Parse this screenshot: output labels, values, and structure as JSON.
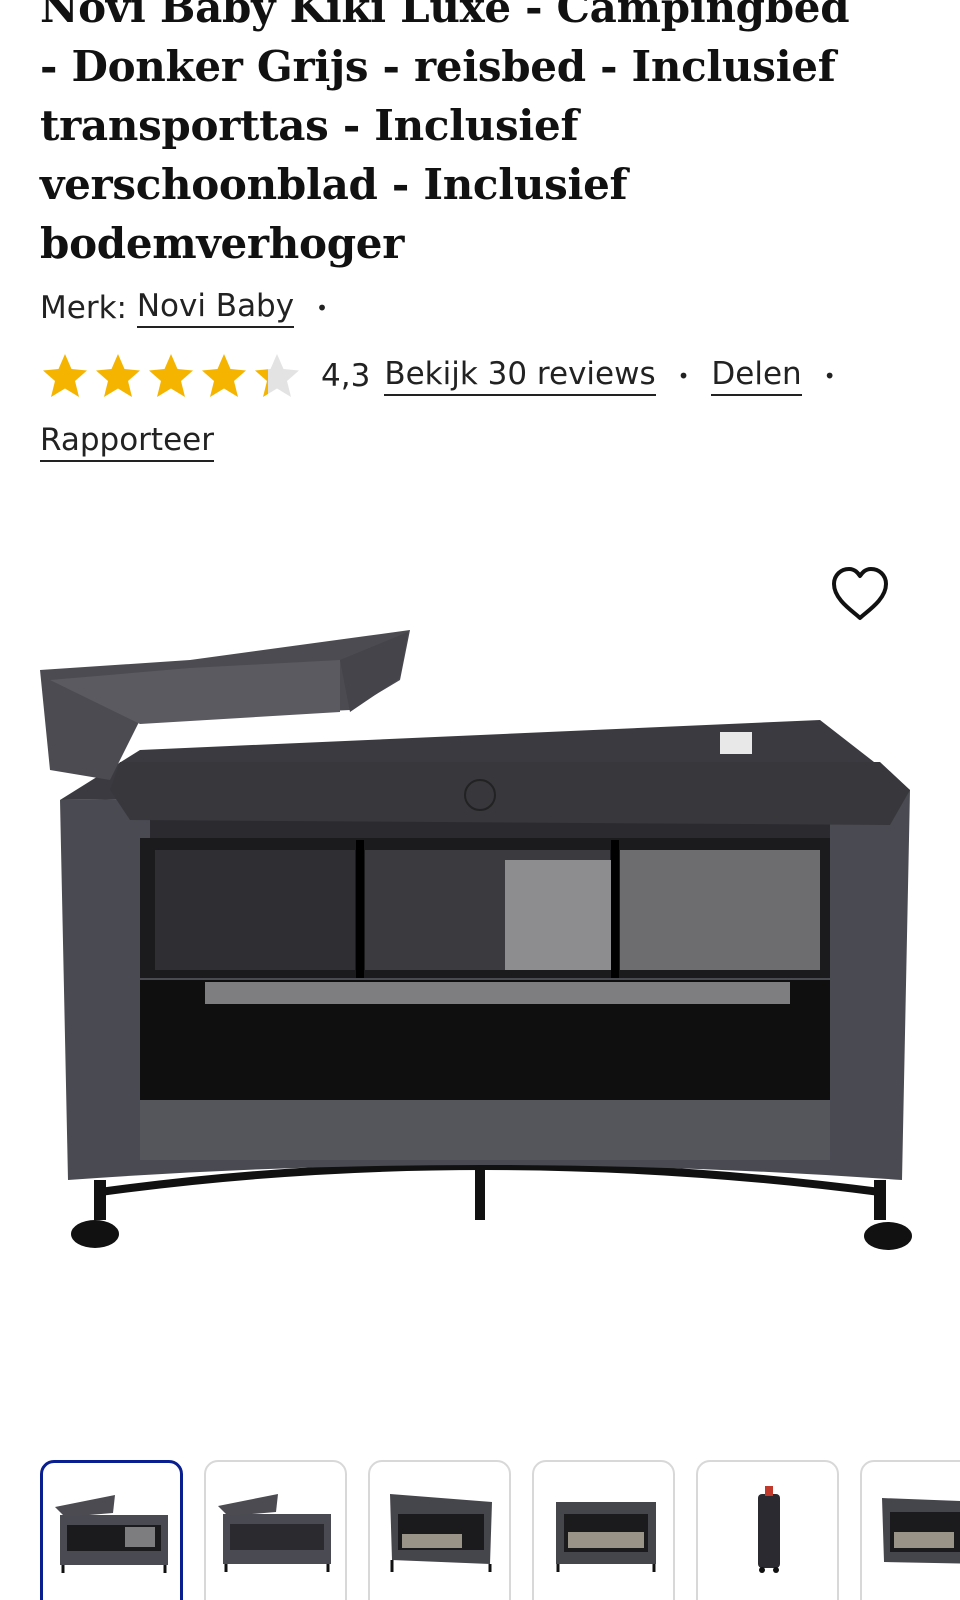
{
  "product": {
    "title_lines": [
      "Novi Baby Kiki Luxe - Campingbed",
      "- Donker Grijs - reisbed - Inclusief",
      "transporttas - Inclusief",
      "verschoonblad - Inclusief",
      "bodemverhoger"
    ],
    "brand_label": "Merk:",
    "brand_name": "Novi Baby",
    "rating_value": "4,3",
    "rating_score": 4.3,
    "rating_max": 5,
    "reviews_link": "Bekijk 30 reviews",
    "share_link": "Delen",
    "report_link": "Rapporteer",
    "separator": "•"
  },
  "colors": {
    "star_filled": "#F5B400",
    "star_empty": "#E3E3E3",
    "thumb_active_border": "#0A1F8F",
    "text": "#111111"
  },
  "icons": {
    "favorite": "heart-outline-icon",
    "rating_star": "star-icon"
  },
  "gallery": {
    "main_image": "Grey travel cot with changing mat",
    "thumbnails": [
      {
        "label": "Camping bed with changing mat, front",
        "selected": true
      },
      {
        "label": "Camping bed with changing mat, side",
        "selected": false
      },
      {
        "label": "Camping bed angled view",
        "selected": false
      },
      {
        "label": "Camping bed front view",
        "selected": false
      },
      {
        "label": "Folded bed in transport bag",
        "selected": false
      },
      {
        "label": "Camping bed angled view 2",
        "selected": false
      }
    ]
  }
}
